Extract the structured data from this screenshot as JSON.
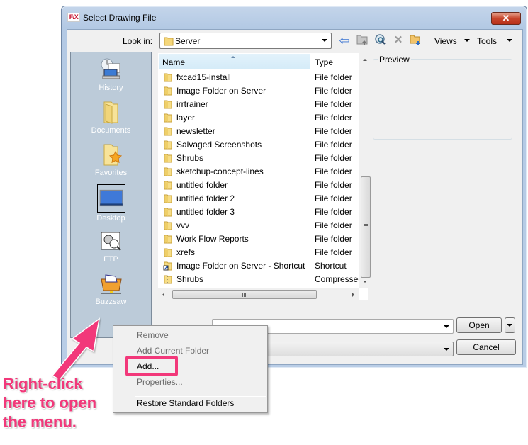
{
  "window": {
    "app_icon_text": "F/X",
    "title": "Select Drawing File",
    "close_glyph": "✕"
  },
  "toolbar": {
    "look_in_label": "Look in:",
    "look_in_value": "Server",
    "icons": [
      "back-arrow-icon",
      "up-folder-icon",
      "search-web-icon",
      "delete-icon",
      "new-folder-icon"
    ],
    "views_label": "Views",
    "tools_label": "Tools"
  },
  "places": [
    {
      "label": "History",
      "icon": "history-icon"
    },
    {
      "label": "Documents",
      "icon": "documents-folder-icon"
    },
    {
      "label": "Favorites",
      "icon": "favorites-icon"
    },
    {
      "label": "Desktop",
      "icon": "desktop-icon"
    },
    {
      "label": "FTP",
      "icon": "ftp-icon"
    },
    {
      "label": "Buzzsaw",
      "icon": "buzzsaw-icon"
    }
  ],
  "filelist": {
    "columns": [
      "Name",
      "Type"
    ],
    "sorted_by": "Name",
    "rows": [
      {
        "name": "fxcad15-install",
        "type": "File folder",
        "icon": "folder-icon"
      },
      {
        "name": "Image Folder on Server",
        "type": "File folder",
        "icon": "folder-icon"
      },
      {
        "name": "irrtrainer",
        "type": "File folder",
        "icon": "folder-icon"
      },
      {
        "name": "layer",
        "type": "File folder",
        "icon": "folder-icon"
      },
      {
        "name": "newsletter",
        "type": "File folder",
        "icon": "folder-icon"
      },
      {
        "name": "Salvaged Screenshots",
        "type": "File folder",
        "icon": "folder-icon"
      },
      {
        "name": "Shrubs",
        "type": "File folder",
        "icon": "folder-icon"
      },
      {
        "name": "sketchup-concept-lines",
        "type": "File folder",
        "icon": "folder-icon"
      },
      {
        "name": "untitled folder",
        "type": "File folder",
        "icon": "folder-icon"
      },
      {
        "name": "untitled folder 2",
        "type": "File folder",
        "icon": "folder-icon"
      },
      {
        "name": "untitled folder 3",
        "type": "File folder",
        "icon": "folder-icon"
      },
      {
        "name": "vvv",
        "type": "File folder",
        "icon": "folder-icon"
      },
      {
        "name": "Work Flow Reports",
        "type": "File folder",
        "icon": "folder-icon"
      },
      {
        "name": "xrefs",
        "type": "File folder",
        "icon": "folder-icon"
      },
      {
        "name": "Image Folder on Server - Shortcut",
        "type": "Shortcut",
        "icon": "shortcut-icon"
      },
      {
        "name": "Shrubs",
        "type": "Compressed",
        "icon": "zip-folder-icon"
      }
    ]
  },
  "preview": {
    "label": "Preview"
  },
  "bottom": {
    "file_name_label": "Fi",
    "file_name_value": "",
    "file_type_value": "",
    "open_label": "Open",
    "cancel_label": "Cancel"
  },
  "context_menu": {
    "items": [
      {
        "label": "Remove",
        "enabled": false
      },
      {
        "label": "Add Current Folder",
        "enabled": false
      },
      {
        "label": "Add...",
        "enabled": true,
        "highlighted": true
      },
      {
        "label": "Properties...",
        "enabled": false
      },
      {
        "label": "Restore Standard Folders",
        "enabled": true
      }
    ]
  },
  "annotation": {
    "lines": [
      "Right-click",
      "here to open",
      "the menu."
    ],
    "color": "#f2387a"
  }
}
